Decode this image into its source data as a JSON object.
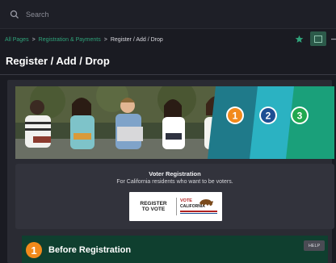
{
  "search": {
    "placeholder": "Search"
  },
  "breadcrumb": {
    "items": [
      "All Pages",
      "Registration & Payments"
    ],
    "current": "Register / Add / Drop",
    "separator": ">"
  },
  "header": {
    "title": "Register / Add / Drop"
  },
  "banner": {
    "steps": [
      "1",
      "2",
      "3"
    ]
  },
  "voter_card": {
    "title": "Voter Registration",
    "subtitle": "For California residents who want to be voters.",
    "button_left_line1": "REGISTER",
    "button_left_line2": "TO VOTE",
    "button_right_line1": "VOTE",
    "button_right_line2": "CALIFORNIA"
  },
  "step_section": {
    "number": "1",
    "title": "Before Registration",
    "help_label": "HELP"
  },
  "colors": {
    "accent_green": "#2fa37a",
    "step1_orange": "#f28a1b",
    "step2_blue": "#1e4f93",
    "step3_green": "#22a84f",
    "section_bg": "#0f3f2f"
  }
}
